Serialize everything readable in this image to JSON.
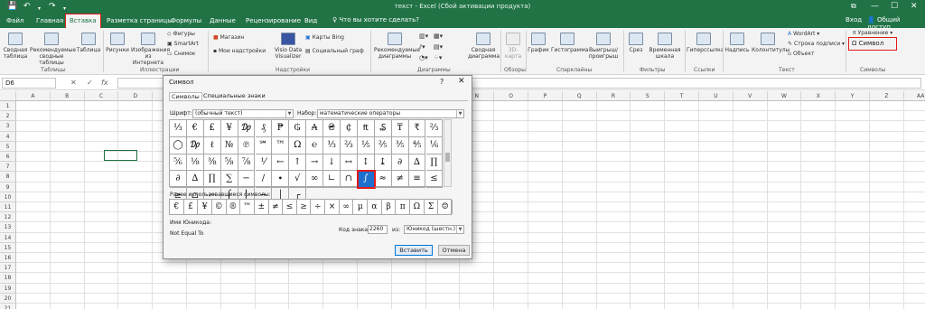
{
  "titlebar": {
    "save_icon": "save-icon",
    "undo_icon": "undo-icon",
    "redo_icon": "redo-icon",
    "window_title": "текст - Excel (Сбой активации продукта)",
    "win_restore": "⧉",
    "win_minimize": "—",
    "win_maximize": "☐",
    "win_close": "✕"
  },
  "tabs": [
    "Файл",
    "Главная",
    "Вставка",
    "Разметка страницы",
    "Формулы",
    "Данные",
    "Рецензирование",
    "Вид"
  ],
  "active_tab": "Вставка",
  "search_text": "Что вы хотите сделать?",
  "login": "Вход",
  "share": "Общий доступ",
  "ribbon": {
    "buttons": [
      "Сводная таблица",
      "Рекомендуемые сводные таблицы",
      "Таблица",
      "Рисунки",
      "Изображения из Интернета",
      "Рекомендуемые диаграммы",
      "Сводная диаграмма",
      "3D-карта",
      "График",
      "Гистограмма",
      "Выигрыш/проигрыш",
      "Срез",
      "Временная шкала",
      "Гиперссылка",
      "Надпись",
      "Колонтитулы"
    ],
    "small": {
      "figures": "Фигуры",
      "smartart": "SmartArt",
      "snapshot": "Снимок",
      "store": "Магазин",
      "my_addins": "Мои надстройки",
      "visio": "Visio Data Visualizer",
      "bing": "Карты Bing",
      "people": "Социальный граф",
      "wordart": "WordArt",
      "signature": "Строка подписи",
      "object": "Объект",
      "equation": "Уравнение",
      "symbol": "Символ"
    },
    "groups": [
      "Таблицы",
      "Иллюстрации",
      "Надстройки",
      "Диаграммы",
      "Обзоры",
      "Спарклайны",
      "Фильтры",
      "Ссылки",
      "Текст",
      "Символы"
    ]
  },
  "formula_bar": {
    "name_box": "D6",
    "cancel": "✕",
    "enter": "✓",
    "fx": "fx"
  },
  "columns": [
    "A",
    "B",
    "C",
    "D",
    "E",
    "F",
    "G",
    "H",
    "I",
    "J",
    "K",
    "L",
    "M",
    "N",
    "O",
    "P",
    "Q",
    "R",
    "S",
    "T",
    "U",
    "V",
    "W",
    "X",
    "Y",
    "Z",
    "AA"
  ],
  "rows": [
    "1",
    "2",
    "3",
    "4",
    "5",
    "6",
    "7",
    "8",
    "9",
    "10",
    "11",
    "12",
    "13",
    "14",
    "15",
    "16",
    "17",
    "18",
    "19",
    "20",
    "21"
  ],
  "dialog": {
    "title": "Символ",
    "help": "?",
    "close": "✕",
    "tab_symbols": "Символы",
    "tab_special": "Специальные знаки",
    "font_label": "Шрифт:",
    "font_value": "(обычный текст)",
    "subset_label": "Набор:",
    "subset_value": "математические операторы",
    "symbols": [
      "⅓",
      "€",
      "£",
      "¥",
      "₯",
      "₰",
      "₱",
      "₲",
      "₳",
      "₴",
      "₵",
      "₶",
      "₷",
      "₸",
      "₹",
      "⅔",
      "◯",
      "₯",
      "ℓ",
      "№",
      "℗",
      "℠",
      "™",
      "Ω",
      "℮",
      "⅓",
      "⅔",
      "⅕",
      "⅖",
      "⅗",
      "⅘",
      "⅙",
      "⅚",
      "⅛",
      "⅜",
      "⅝",
      "⅞",
      "⅟",
      "←",
      "↑",
      "→",
      "↓",
      "↔",
      "↕",
      "↨",
      "∂",
      "∆",
      "∏",
      "∂",
      "∆",
      "∏",
      "∑",
      "−",
      "∕",
      "∙",
      "√",
      "∞",
      "∟",
      "∩",
      "∫",
      "≈",
      "≠",
      "≡",
      "≤",
      "≥",
      "⌂",
      "⌐",
      "⌠",
      "⌡",
      "─",
      "│",
      "┌"
    ],
    "selected_index": 59,
    "recent_label": "Ранее использовавшиеся символы:",
    "recent": [
      "€",
      "£",
      "¥",
      "©",
      "®",
      "™",
      "±",
      "≠",
      "≤",
      "≥",
      "÷",
      "×",
      "∞",
      "µ",
      "α",
      "β",
      "π",
      "Ω",
      "Σ",
      "☺"
    ],
    "unicode_name_label": "Имя Юникода:",
    "unicode_name": "Not Equal To",
    "code_label": "Код знака:",
    "code_value": "2260",
    "from_label": "из:",
    "from_value": "Юникод (шестн.)",
    "insert": "Вставить",
    "cancel": "Отмена"
  },
  "colors": {
    "excel_green": "#217346",
    "highlight_red": "#e21a1a",
    "selection_blue": "#1e70cf"
  }
}
